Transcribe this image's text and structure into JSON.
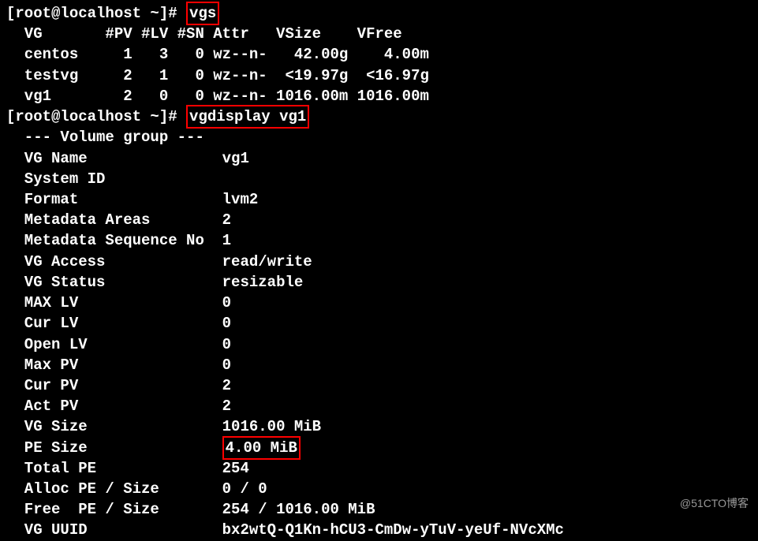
{
  "prompt1": {
    "prefix": "[root@localhost ~]# ",
    "cmd": "vgs"
  },
  "vgs_header": "  VG       #PV #LV #SN Attr   VSize    VFree",
  "vgs_rows": [
    "  centos     1   3   0 wz--n-   42.00g    4.00m",
    "  testvg     2   1   0 wz--n-  <19.97g  <16.97g",
    "  vg1        2   0   0 wz--n- 1016.00m 1016.00m"
  ],
  "prompt2": {
    "prefix": "[root@localhost ~]# ",
    "cmd": "vgdisplay vg1"
  },
  "vgdisp_header": "  --- Volume group ---",
  "vgdisp_fields": [
    {
      "label": "  VG Name               ",
      "value": "vg1"
    },
    {
      "label": "  System ID             ",
      "value": ""
    },
    {
      "label": "  Format                ",
      "value": "lvm2"
    },
    {
      "label": "  Metadata Areas        ",
      "value": "2"
    },
    {
      "label": "  Metadata Sequence No  ",
      "value": "1"
    },
    {
      "label": "  VG Access             ",
      "value": "read/write"
    },
    {
      "label": "  VG Status             ",
      "value": "resizable"
    },
    {
      "label": "  MAX LV                ",
      "value": "0"
    },
    {
      "label": "  Cur LV                ",
      "value": "0"
    },
    {
      "label": "  Open LV               ",
      "value": "0"
    },
    {
      "label": "  Max PV                ",
      "value": "0"
    },
    {
      "label": "  Cur PV                ",
      "value": "2"
    },
    {
      "label": "  Act PV                ",
      "value": "2"
    },
    {
      "label": "  VG Size               ",
      "value": "1016.00 MiB"
    }
  ],
  "pe_size": {
    "label": "  PE Size               ",
    "value": "4.00 MiB"
  },
  "vgdisp_tail": [
    {
      "label": "  Total PE              ",
      "value": "254"
    },
    {
      "label": "  Alloc PE / Size       ",
      "value": "0 / 0"
    },
    {
      "label": "  Free  PE / Size       ",
      "value": "254 / 1016.00 MiB"
    },
    {
      "label": "  VG UUID               ",
      "value": "bx2wtQ-Q1Kn-hCU3-CmDw-yTuV-yeUf-NVcXMc"
    }
  ],
  "watermark": "@51CTO博客"
}
